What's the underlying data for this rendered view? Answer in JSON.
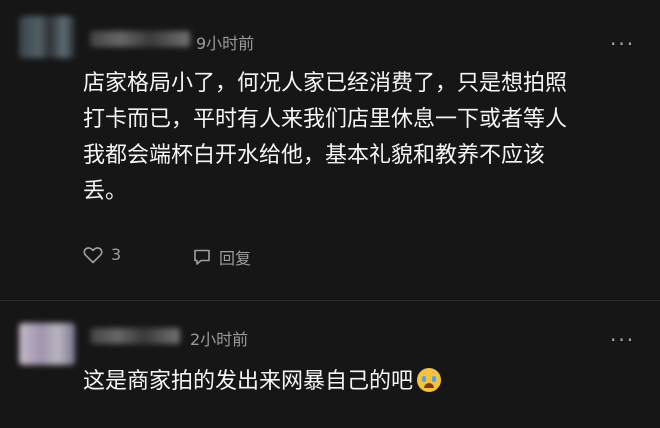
{
  "comments": [
    {
      "time": "9小时前",
      "text_lines": [
        "店家格局小了，何况人家已经消费了，只是想拍照",
        "打卡而已，平时有人来我们店里休息一下或者等人",
        "我都会端杯白开水给他，基本礼貌和教养不应该",
        "丢。"
      ],
      "like_count": "3",
      "reply_label": "回复"
    },
    {
      "time": "2小时前",
      "text": "这是商家拍的发出来网暴自己的吧"
    }
  ],
  "icons": {
    "more": "more-dots-icon",
    "like": "heart-icon",
    "reply": "speech-bubble-icon",
    "emoji": "crying-laughing-emoji"
  },
  "colors": {
    "background": "#161617",
    "text": "#f5f5f5",
    "muted": "#9a9a9a"
  }
}
